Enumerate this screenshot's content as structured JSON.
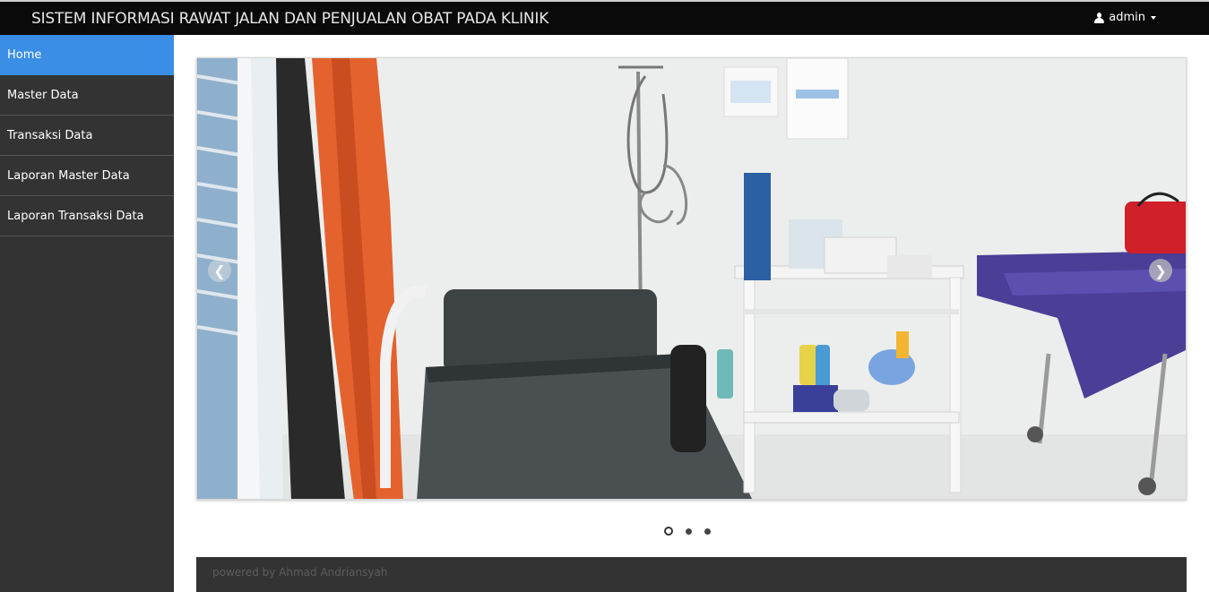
{
  "header": {
    "title": "SISTEM INFORMASI RAWAT JALAN DAN PENJUALAN OBAT PADA KLINIK",
    "user": "admin",
    "user_icon": "user-icon",
    "caret_icon": "caret-down-icon"
  },
  "sidebar": {
    "items": [
      {
        "label": "Home",
        "active": true
      },
      {
        "label": "Master Data",
        "active": false
      },
      {
        "label": "Transaksi Data",
        "active": false
      },
      {
        "label": "Laporan Master Data",
        "active": false
      },
      {
        "label": "Laporan Transaksi Data",
        "active": false
      }
    ]
  },
  "carousel": {
    "prev_icon": "chevron-left-icon",
    "next_icon": "chevron-right-icon",
    "slide_count": 3,
    "active_index": 0
  },
  "footer": {
    "text": "powered by Ahmad Andriansyah"
  },
  "colors": {
    "topbar": "#0a0a0a",
    "sidebar": "#333333",
    "active_item": "#3a8ee6",
    "footer": "#333333"
  }
}
